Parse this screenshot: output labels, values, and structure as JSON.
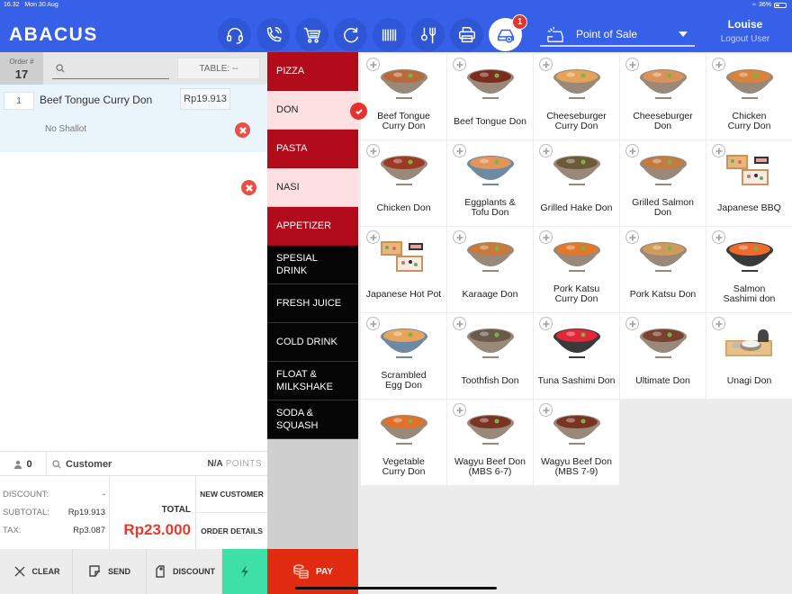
{
  "status_bar": {
    "time": "16.32",
    "date": "Mon 30 Aug",
    "battery": "36%"
  },
  "header": {
    "logo": "ABACUS",
    "toolbar_icons": [
      "headset-icon",
      "phone-icon",
      "cart-icon",
      "refresh-icon",
      "barcode-icon",
      "cutlery-icon",
      "printer-icon",
      "order-add-icon"
    ],
    "active_icon_badge": "1",
    "mode_select": {
      "value": "Point of Sale"
    },
    "user": {
      "name": "Louise",
      "logout_label": "Logout User"
    }
  },
  "order": {
    "order_label": "Order #",
    "order_number": "17",
    "search_placeholder": "",
    "table_label": "TABLE: --",
    "items": [
      {
        "qty": "1",
        "name": "Beef Tongue Curry Don",
        "price": "Rp19.913",
        "modifier": "No Shallot"
      }
    ],
    "guest_count": "0",
    "customer_label": "Customer",
    "points_value": "N/A",
    "points_label": "POINTS",
    "summary": {
      "discount_label": "DISCOUNT:",
      "discount_value": "-",
      "subtotal_label": "SUBTOTAL:",
      "subtotal_value": "Rp19.913",
      "tax_label": "TAX:",
      "tax_value": "Rp3.087",
      "total_label": "TOTAL",
      "total_value": "Rp23.000"
    },
    "new_customer_label": "NEW CUSTOMER",
    "order_details_label": "ORDER DETAILS",
    "actions": {
      "clear": "CLEAR",
      "send": "SEND",
      "discount": "DISCOUNT",
      "pay": "PAY"
    }
  },
  "categories": [
    {
      "label": "PIZZA",
      "style": "red"
    },
    {
      "label": "DON",
      "style": "pink",
      "selected": true
    },
    {
      "label": "PASTA",
      "style": "red"
    },
    {
      "label": "NASI",
      "style": "pink"
    },
    {
      "label": "APPETIZER",
      "style": "red"
    },
    {
      "label": "SPESIAL\nDRINK",
      "style": "black"
    },
    {
      "label": "FRESH JUICE",
      "style": "black"
    },
    {
      "label": "COLD DRINK",
      "style": "black"
    },
    {
      "label": "FLOAT &\nMILKSHAKE",
      "style": "black"
    },
    {
      "label": "SODA &\nSQUASH",
      "style": "black"
    }
  ],
  "products": [
    {
      "name": "Beef Tongue\nCurry Don",
      "plus": true,
      "dish": "bowl",
      "food": "#b86a3a"
    },
    {
      "name": "Beef Tongue Don",
      "plus": true,
      "dish": "bowl",
      "food": "#7a2c1e"
    },
    {
      "name": "Cheeseburger\nCurry Don",
      "plus": true,
      "dish": "bowl",
      "food": "#e3a35a"
    },
    {
      "name": "Cheeseburger\nDon",
      "plus": true,
      "dish": "bowl",
      "food": "#d9925a"
    },
    {
      "name": "Chicken\nCurry Don",
      "plus": true,
      "dish": "bowl",
      "food": "#d8833e"
    },
    {
      "name": "Chicken Don",
      "plus": true,
      "dish": "bowl",
      "food": "#9d3a22"
    },
    {
      "name": "Eggplants &\nTofu Don",
      "plus": true,
      "dish": "bowl-blue",
      "food": "#e39458"
    },
    {
      "name": "Grilled Hake Don",
      "plus": true,
      "dish": "bowl",
      "food": "#6b5a3a"
    },
    {
      "name": "Grilled Salmon\nDon",
      "plus": true,
      "dish": "bowl",
      "food": "#c47b40"
    },
    {
      "name": "Japanese BBQ",
      "plus": true,
      "dish": "box",
      "food": "#e8b87a"
    },
    {
      "name": "Japanese Hot Pot",
      "plus": true,
      "dish": "box",
      "food": "#e8b87a"
    },
    {
      "name": "Karaage Don",
      "plus": true,
      "dish": "bowl",
      "food": "#c77a3a"
    },
    {
      "name": "Pork Katsu\nCurry Don",
      "plus": true,
      "dish": "bowl",
      "food": "#e07a2a"
    },
    {
      "name": "Pork Katsu Don",
      "plus": true,
      "dish": "bowl",
      "food": "#cf9a5a"
    },
    {
      "name": "Salmon\nSashimi don",
      "plus": true,
      "dish": "bowl-dark",
      "food": "#ee6a2e"
    },
    {
      "name": "Scrambled\nEgg Don",
      "plus": true,
      "dish": "bowl-blue",
      "food": "#e8a45a"
    },
    {
      "name": "Toothfish Don",
      "plus": true,
      "dish": "bowl",
      "food": "#6a5a4a"
    },
    {
      "name": "Tuna Sashimi Don",
      "plus": true,
      "dish": "bowl-dark",
      "food": "#e0283a"
    },
    {
      "name": "Ultimate Don",
      "plus": true,
      "dish": "bowl",
      "food": "#7a4030"
    },
    {
      "name": "Unagi Don",
      "plus": true,
      "dish": "tray",
      "food": "#caa070"
    },
    {
      "name": "Vegetable\nCurry Don",
      "plus": false,
      "dish": "bowl",
      "food": "#e0702a"
    },
    {
      "name": "Wagyu Beef Don\n(MBS 6-7)",
      "plus": true,
      "dish": "bowl",
      "food": "#7a3424"
    },
    {
      "name": "Wagyu Beef Don\n(MBS 7-9)",
      "plus": true,
      "dish": "bowl",
      "food": "#7a3424"
    }
  ],
  "colors": {
    "header_blue": "#3760e8",
    "category_red": "#b20c1c",
    "category_pink": "#ffe0e2",
    "category_black": "#050505",
    "total_red": "#e8392a",
    "pay_red": "#e02b10",
    "quick_green": "#3fe0a8"
  }
}
